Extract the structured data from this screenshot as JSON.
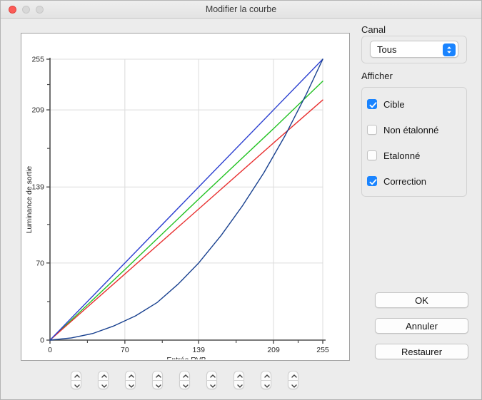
{
  "window": {
    "title": "Modifier la courbe",
    "traffic_lights": [
      "close",
      "minimize",
      "zoom"
    ]
  },
  "channel": {
    "group_label": "Canal",
    "selected": "Tous",
    "options": [
      "Tous"
    ]
  },
  "display": {
    "group_label": "Afficher",
    "checkboxes": [
      {
        "label": "Cible",
        "checked": true
      },
      {
        "label": "Non étalonné",
        "checked": false
      },
      {
        "label": "Etalonné",
        "checked": false
      },
      {
        "label": "Correction",
        "checked": true
      }
    ]
  },
  "actions": {
    "ok": "OK",
    "cancel": "Annuler",
    "restore": "Restaurer"
  },
  "steppers": {
    "count": 9,
    "icon_up": "chevron-up-icon",
    "icon_down": "chevron-down-icon"
  },
  "colors": {
    "accent": "#1a84ff",
    "curve_target": "#2b3fd0",
    "curve_red": "#e83030",
    "curve_green": "#22c222",
    "curve_correction": "#18408f",
    "grid": "#dcdcdc",
    "axis": "#4d4d4d",
    "window_bg": "#ececec",
    "plot_bg": "#ffffff"
  },
  "chart_data": {
    "type": "line",
    "title": "",
    "xlabel": "Entrée RVB",
    "ylabel": "Luminance de sortie",
    "xlim": [
      0,
      255
    ],
    "ylim": [
      0,
      255
    ],
    "xticks": [
      0,
      70,
      139,
      209,
      255
    ],
    "yticks": [
      0,
      70,
      139,
      209,
      255
    ],
    "xtick_labels": [
      "0",
      "70",
      "139",
      "209",
      "255"
    ],
    "ytick_labels": [
      "0",
      "70",
      "139",
      "209",
      "255"
    ],
    "minor_ticks": true,
    "grid": true,
    "legend": "none",
    "series": [
      {
        "name": "Cible (bleu)",
        "color": "#2b3fd0",
        "x": [
          0,
          70,
          139,
          209,
          255
        ],
        "y": [
          0,
          70,
          139,
          209,
          255
        ]
      },
      {
        "name": "Vert",
        "color": "#22c222",
        "x": [
          0,
          70,
          139,
          209,
          255
        ],
        "y": [
          0,
          64,
          128,
          192,
          235
        ]
      },
      {
        "name": "Rouge",
        "color": "#e83030",
        "x": [
          0,
          70,
          139,
          209,
          255
        ],
        "y": [
          0,
          60,
          119,
          179,
          218
        ]
      },
      {
        "name": "Correction",
        "color": "#18408f",
        "x": [
          0,
          20,
          40,
          60,
          80,
          100,
          120,
          139,
          160,
          180,
          200,
          220,
          240,
          255
        ],
        "y": [
          0,
          2,
          6,
          13,
          22,
          34,
          51,
          70,
          95,
          122,
          152,
          186,
          224,
          255
        ]
      }
    ]
  }
}
